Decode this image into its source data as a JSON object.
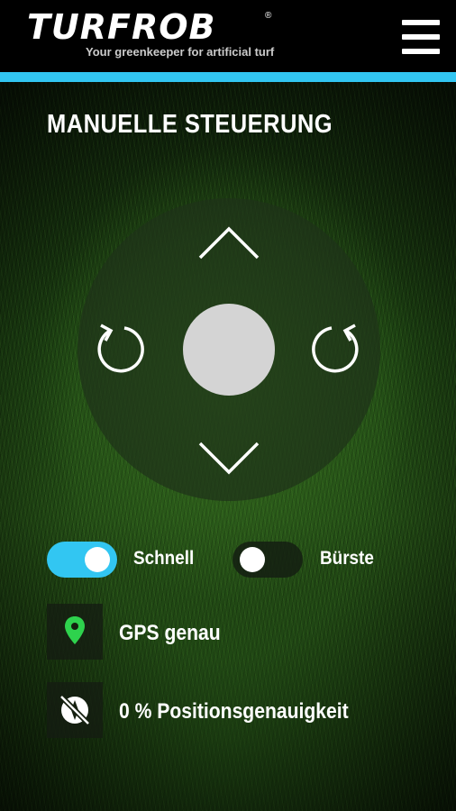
{
  "header": {
    "logo_text": "TURFROB",
    "registered_mark": "®",
    "tagline": "Your greenkeeper for artificial turf",
    "menu_icon": "hamburger-menu-icon",
    "accent_color": "#32c6f2"
  },
  "page": {
    "title": "MANUELLE STEUERUNG"
  },
  "controls": {
    "up_icon": "chevron-up-icon",
    "down_icon": "chevron-down-icon",
    "rotate_left_icon": "rotate-left-icon",
    "rotate_right_icon": "rotate-right-icon",
    "center_icon": "joystick-knob"
  },
  "toggles": [
    {
      "label": "Schnell",
      "on": true,
      "on_color": "#32c6f2"
    },
    {
      "label": "Bürste",
      "on": false
    }
  ],
  "status": [
    {
      "icon": "map-pin-icon",
      "icon_color": "#2ed24d",
      "text": "GPS genau"
    },
    {
      "icon": "compass-off-icon",
      "text": "0 % Positionsgenauigkeit"
    }
  ]
}
